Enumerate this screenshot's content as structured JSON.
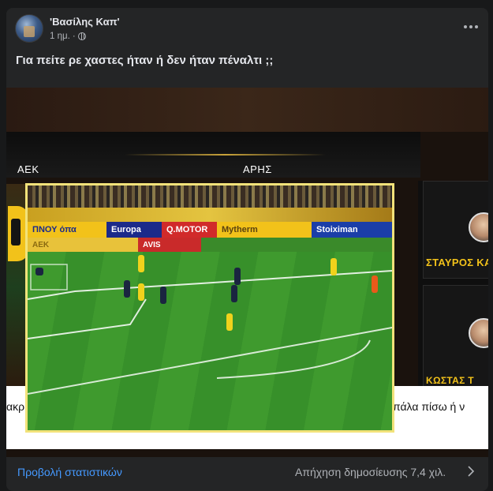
{
  "post": {
    "author": "'Βασίλης Καπ'",
    "time": "1 ημ.",
    "separator": "·",
    "text": "Για πείτε ρε χαστες ήταν ή δεν ήταν πέναλτι ;;"
  },
  "video": {
    "team_left": "ΑΕΚ",
    "team_right": "ΑΡΗΣ",
    "panel_name_1": "ΣΤΑΥΡΟΣ ΚΑΖ",
    "panel_name_2": "ΚΩΣΤΑΣ Τ",
    "subtitle_left": "ακρ",
    "subtitle_right": "πάλα πίσω ή ν",
    "ads": {
      "ad1": "ΠΝΟΥ όπα",
      "ad2": "Europa",
      "ad3": "Q.MOTOR",
      "ad4": "Mytherm",
      "ad5": "Stoiximan",
      "ad6": "ΑΕΚ",
      "ad7": "AVIS"
    }
  },
  "footer": {
    "stats_link": "Προβολή στατιστικών",
    "reach": "Απήχηση δημοσίευσης 7,4 χιλ."
  },
  "colors": {
    "background": "#18191a",
    "card": "#242526",
    "link": "#4599ff",
    "text": "#e4e6eb",
    "secondary": "#b0b3b8"
  },
  "icons": [
    "more-options-icon",
    "globe-icon",
    "mute-icon",
    "chevron-right-icon"
  ]
}
